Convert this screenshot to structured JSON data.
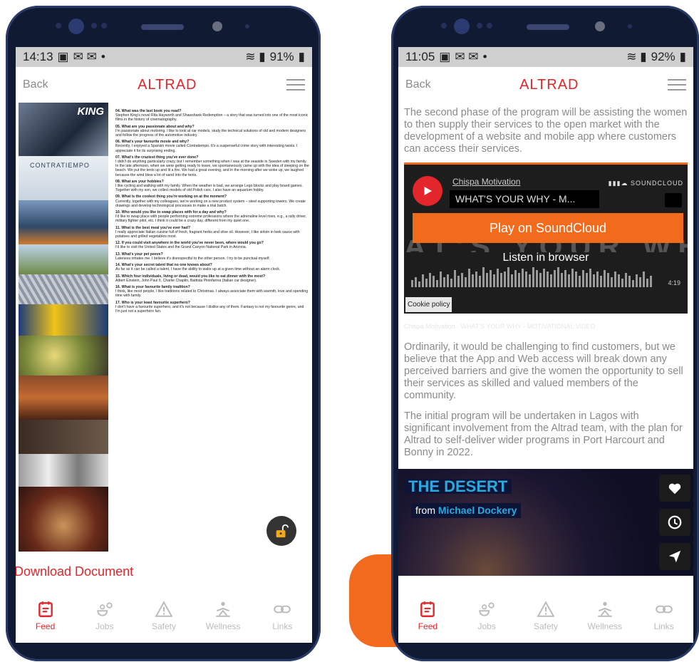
{
  "left_phone": {
    "status": {
      "time": "14:13",
      "battery": "91%"
    },
    "header": {
      "back": "Back",
      "brand": "ALTRAD"
    },
    "strip_labels": {
      "king": "KING",
      "contratiempo": "CONTRATIEMPO"
    },
    "qa": [
      {
        "q": "04. What was the last book you read?",
        "a": "Stephen King's novel Rita Hayworth and Shawshank Redemption – a story that was turned into one of the most iconic films in the history of cinematography."
      },
      {
        "q": "05. What are you passionate about and why?",
        "a": "I'm passionate about motoring. I like to look at car models, study the technical solutions of old and modern designers and follow the progress of the automotive industry."
      },
      {
        "q": "06. What's your favourite movie and why?",
        "a": "Recently, I enjoyed a Spanish movie called Contratiempo. It's a suspenseful crime story with interesting twists. I appreciate it for its surprising ending."
      },
      {
        "q": "07. What's the craziest thing you've ever done?",
        "a": "I didn't do anything particularly crazy, but I remember something when I was at the seaside in Sweden with my family. In the late afternoon, when we were getting ready to leave, we spontaneously came up with the idea of sleeping on the beach. We put the tents up and lit a fire. We had a great evening, and in the morning after we woke up, we laughed because the wind blew a lot of sand into the tents."
      },
      {
        "q": "08. What are your hobbies?",
        "a": "I like cycling and walking with my family. When the weather is bad, we arrange Lego blocks and play board games. Together with my son, we collect models of old Polish cars. I also have an aquarium hobby."
      },
      {
        "q": "09. What is the coolest thing you're working on at the moment?",
        "a": "Currently, together with my colleagues, we're working on a new product system – steel supporting towers. We create drawings and develop technological processes to make a trial batch."
      },
      {
        "q": "10. Who would you like to swap places with for a day and why?",
        "a": "I'd like to swap place with people performing extreme professions where the adrenaline level rises, e.g., a rally driver, military fighter pilot, etc. I think it could be a crazy day, different from my quiet one."
      },
      {
        "q": "11. What is the best meal you've ever had?",
        "a": "I really appreciate Italian cuisine full of fresh, fragrant herbs and olive oil. However, I like sirloin in leek sauce with potatoes and grilled vegetables most."
      },
      {
        "q": "12. If you could visit anywhere in the world you've never been, where would you go?",
        "a": "I'd like to visit the United States and the Grand Canyon National Park in Arizona."
      },
      {
        "q": "13. What's your pet peeve?",
        "a": "Lateness irritates me. I believe it's disrespectful to the other person. I try to be punctual myself."
      },
      {
        "q": "14. What's your secret talent that no one knows about?",
        "a": "As far as it can be called a talent, I have the ability to wake up at a given time without an alarm clock."
      },
      {
        "q": "15. Which four individuals, living or dead, would you like to eat dinner with the most?",
        "a": "Albert Einstein, John Paul II, Charlie Chaplin, Battista Pininfarina (Italian car designer)."
      },
      {
        "q": "16. What is your favourite family tradition?",
        "a": "I think, like most people, I like traditions related to Christmas. I always associate them with warmth, love and spending time with family."
      },
      {
        "q": "17. Who is your least favourite superhero?",
        "a": "I don't have a favourite superhero, and it's not because I dislike any of them. Fantasy is not my favourite genre, and I'm just not a superhero fan."
      }
    ],
    "download": "Download Document",
    "tabs": [
      "Feed",
      "Jobs",
      "Safety",
      "Wellness",
      "Links"
    ]
  },
  "right_phone": {
    "status": {
      "time": "11:05",
      "battery": "92%"
    },
    "header": {
      "back": "Back",
      "brand": "ALTRAD"
    },
    "para1": "The second phase of the program will be assisting the women to then supply their services to the open market with the development of a website and mobile app where customers can access their services.",
    "soundcloud": {
      "artist": "Chispa Motivation",
      "title": "WHAT'S YOUR WHY - M...",
      "logo": "SOUNDCLOUD",
      "play_button": "Play on SoundCloud",
      "background_text": "AT'S YOUR WH",
      "listen": "Listen in browser",
      "duration": "4:19",
      "cookie": "Cookie policy"
    },
    "caption": "Chispa Motivation · WHAT'S YOUR WHY - MOTIVATIONAL VIDEO",
    "para2": "Ordinarily, it would be challenging to find customers, but we believe that the App and Web access will break down any perceived barriers and give the women the opportunity to sell their services as skilled and valued members of the community.",
    "para3": "The initial program will be undertaken in Lagos with significant involvement from the Altrad team, with the plan for Altrad to self-deliver wider programs in Port Harcourt and Bonny in 2022.",
    "video": {
      "title": "THE DESERT",
      "from": "from",
      "author": "Michael Dockery"
    },
    "tabs": [
      "Feed",
      "Jobs",
      "Safety",
      "Wellness",
      "Links"
    ]
  },
  "colors": {
    "accent": "#e3262b",
    "soundcloud_orange": "#f26b1d",
    "frame": "#101a33"
  }
}
